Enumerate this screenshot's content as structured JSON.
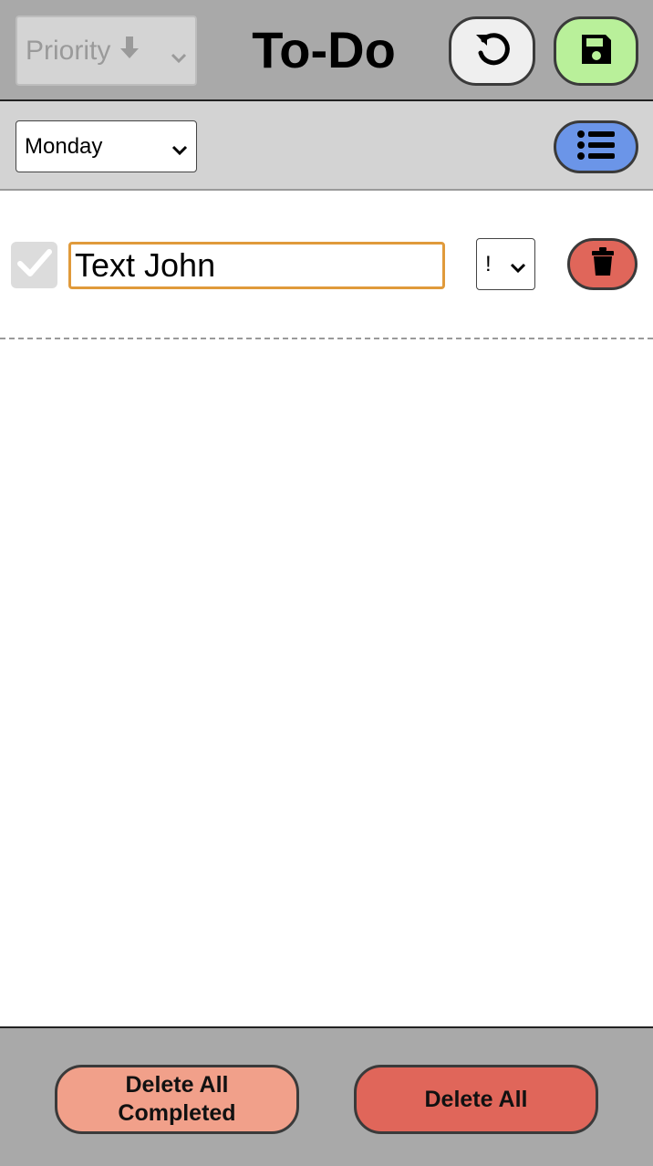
{
  "header": {
    "sort_select": {
      "label": "Priority",
      "arrow_icon": "arrow-down-icon"
    },
    "title": "To-Do",
    "undo_icon": "undo-icon",
    "save_icon": "floppy-disk-icon"
  },
  "toolbar": {
    "day_select": {
      "value": "Monday"
    },
    "list_icon": "list-icon"
  },
  "tasks": [
    {
      "completed": true,
      "text": "Text John",
      "priority": "!",
      "delete_icon": "trash-icon"
    }
  ],
  "footer": {
    "delete_completed_label": "Delete All Completed",
    "delete_all_label": "Delete All"
  },
  "colors": {
    "save": "#b9f09a",
    "list": "#6b95e8",
    "delete": "#e0665a",
    "delete_completed": "#f1a08a",
    "input_border": "#e09a3b"
  }
}
